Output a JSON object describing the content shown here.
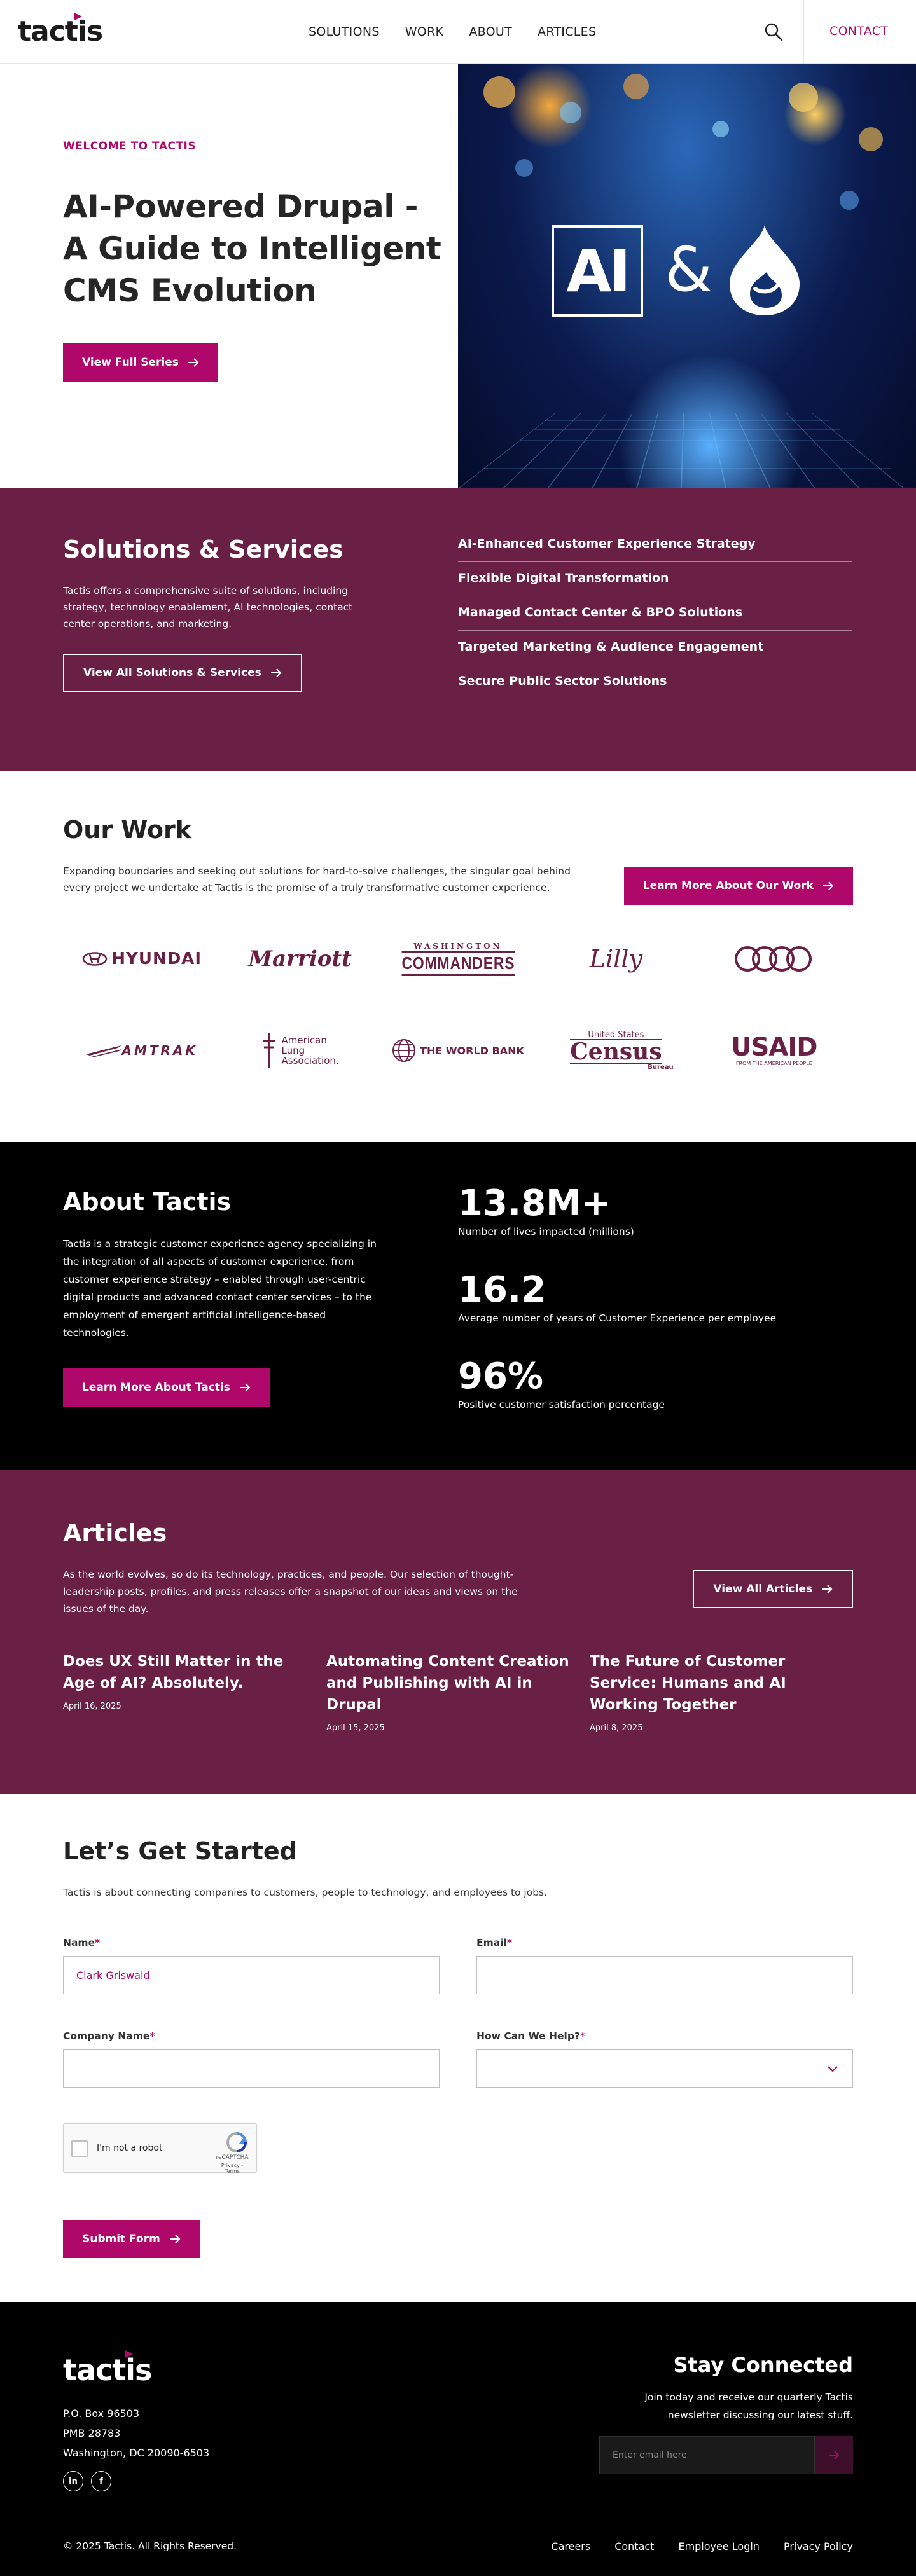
{
  "nav": {
    "logo": "tactis",
    "items": [
      "SOLUTIONS",
      "WORK",
      "ABOUT",
      "ARTICLES"
    ],
    "contact": "CONTACT"
  },
  "hero": {
    "eyebrow": "WELCOME TO TACTIS",
    "title": "AI-Powered Drupal - A Guide to Intelligent CMS Evolution",
    "button": "View Full Series",
    "image_ai": "AI",
    "image_amp": "&"
  },
  "solutions": {
    "title": "Solutions & Services",
    "text": "Tactis offers a comprehensive suite of solutions, including strategy, technology enablement, AI technologies, contact center operations, and marketing.",
    "button": "View All Solutions & Services",
    "items": [
      "AI-Enhanced Customer Experience Strategy",
      "Flexible Digital Transformation",
      "Managed Contact Center & BPO Solutions",
      "Targeted Marketing & Audience Engagement",
      "Secure Public Sector Solutions"
    ]
  },
  "work": {
    "title": "Our Work",
    "text": "Expanding boundaries and seeking out solutions for hard-to-solve challenges, the singular goal behind every project we undertake at Tactis is the promise of a truly transformative customer experience.",
    "button": "Learn More About Our Work",
    "logos": {
      "hyundai": "HYUNDAI",
      "marriott": "Marriott",
      "commanders_top": "WASHINGTON",
      "commanders": "COMMANDERS",
      "lilly": "Lilly",
      "amtrak": "AMTRAK",
      "ala1": "American",
      "ala2": "Lung",
      "ala3": "Association.",
      "worldbank": "THE WORLD BANK",
      "census_top": "United States",
      "census": "Census",
      "census_bottom": "Bureau",
      "usaid": "USAID",
      "usaid_sub": "FROM THE AMERICAN PEOPLE"
    }
  },
  "about": {
    "title": "About Tactis",
    "text": "Tactis is a strategic customer experience agency specializing in the integration of all aspects of customer experience, from customer experience strategy – enabled through user-centric digital products and advanced contact center services – to the employment of emergent artificial intelligence-based technologies.",
    "button": "Learn More About Tactis",
    "stats": [
      {
        "value": "13.8M+",
        "label": "Number of lives impacted (millions)"
      },
      {
        "value": "16.2",
        "label": "Average number of years of Customer Experience per employee"
      },
      {
        "value": "96%",
        "label": "Positive customer satisfaction percentage"
      }
    ]
  },
  "articles": {
    "title": "Articles",
    "text": "As the world evolves, so do its technology, practices, and people. Our selection of thought-leadership posts, profiles, and press releases offer a snapshot of our ideas and views on the issues of the day.",
    "button": "View All Articles",
    "items": [
      {
        "title": "Does UX Still Matter in the Age of AI? Absolutely.",
        "date": "April 16, 2025"
      },
      {
        "title": "Automating Content Creation and Publishing with AI in Drupal",
        "date": "April 15, 2025"
      },
      {
        "title": "The Future of Customer Service: Humans and AI Working Together",
        "date": "April 8, 2025"
      }
    ]
  },
  "form": {
    "title": "Let’s Get Started",
    "intro": "Tactis is about connecting companies to customers, people to technology, and employees to jobs.",
    "fields": {
      "name_label": "Name",
      "name_value": "Clark Griswald",
      "email_label": "Email",
      "email_value": "",
      "company_label": "Company Name",
      "company_value": "",
      "help_label": "How Can We Help?",
      "help_value": ""
    },
    "required_mark": "*",
    "captcha_label": "I'm not a robot",
    "captcha_brand": "reCAPTCHA",
    "captcha_terms": "Privacy - Terms",
    "submit": "Submit Form"
  },
  "footer": {
    "logo": "tactis",
    "address": [
      "P.O. Box 96503",
      "PMB 28783",
      "Washington, DC 20090-6503"
    ],
    "social_linkedin": "in",
    "social_facebook": "f",
    "stay_title": "Stay Connected",
    "stay_text": "Join today and receive our quarterly Tactis newsletter discussing our latest stuff.",
    "email_placeholder": "Enter email here",
    "copyright": "© 2025 Tactis. All Rights Reserved.",
    "links": [
      "Careers",
      "Contact",
      "Employee Login",
      "Privacy Policy"
    ]
  },
  "colors": {
    "brand": "#b0086a",
    "plum": "#6a1f44",
    "black": "#000000"
  }
}
